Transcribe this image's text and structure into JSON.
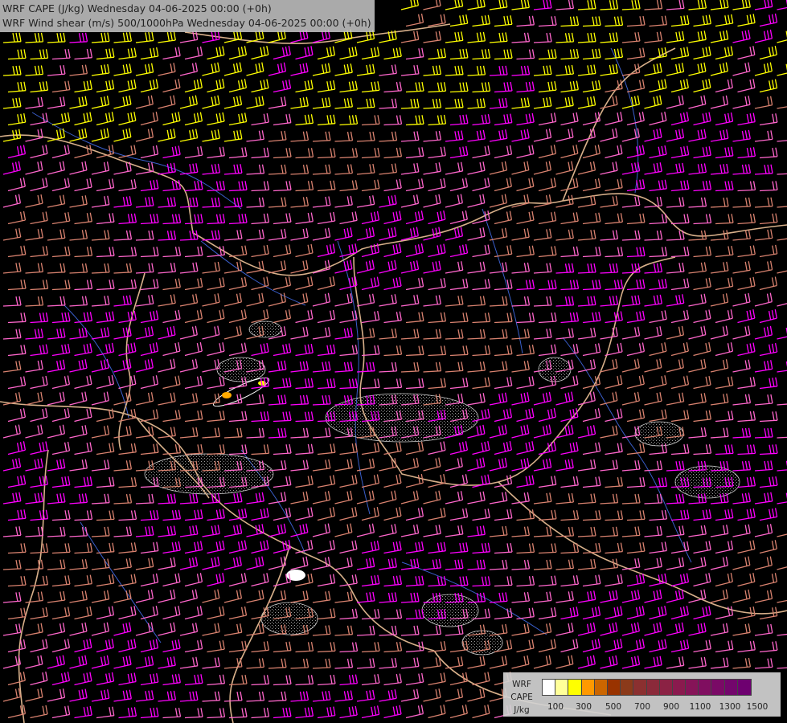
{
  "header": {
    "title_line1": "WRF CAPE (J/kg) Wednesday 04-06-2025 00:00 (+0h)",
    "title_line2": "WRF Wind shear (m/s) 500/1000hPa Wednesday 04-06-2025 00:00 (+0h)"
  },
  "legend": {
    "label_lines": [
      "WRF",
      "CAPE",
      "J/kg"
    ],
    "ticks": [
      "100",
      "300",
      "500",
      "700",
      "900",
      "1100",
      "1300",
      "1500"
    ],
    "colors": [
      "#ffffff",
      "#ffff99",
      "#ffff00",
      "#ff9900",
      "#cc6600",
      "#993300",
      "#8b3a1a",
      "#8b3030",
      "#8b2a3a",
      "#8b2244",
      "#8a1a4e",
      "#861458",
      "#800e60",
      "#7a0a66",
      "#73066c",
      "#6e0070"
    ]
  },
  "map": {
    "background_color": "#000000",
    "barb_colors": {
      "weak": "#d9826f",
      "moderate": "#ff66cc",
      "strong": "#ff00ff",
      "very_strong": "#ffff00"
    },
    "border_color": "#d8b08a",
    "river_color": "#3a5fcd",
    "cape_contour_color": "#cfcfcf"
  }
}
